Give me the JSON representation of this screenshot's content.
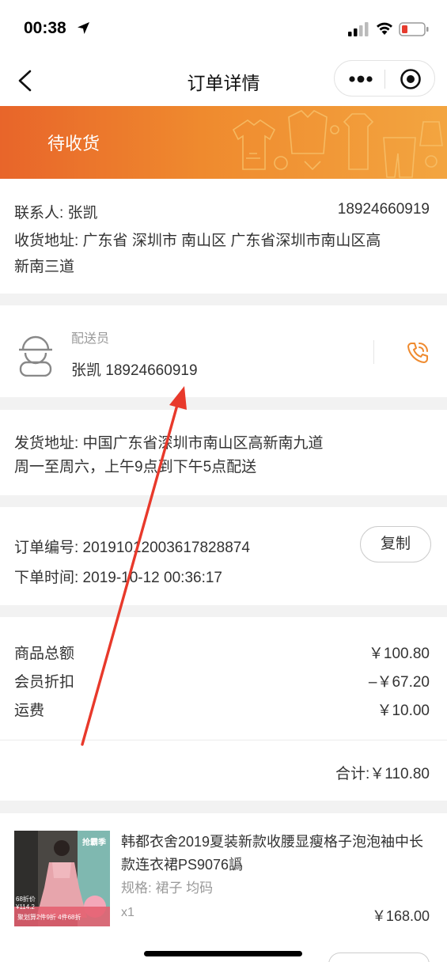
{
  "status_bar": {
    "time": "00:38"
  },
  "nav": {
    "title": "订单详情"
  },
  "banner": {
    "status": "待收货"
  },
  "contact": {
    "name_label": "联系人: 张凯",
    "phone": "18924660919",
    "address_line1": "收货地址: 广东省  深圳市  南山区  广东省深圳市南山区高",
    "address_line2": "新南三道"
  },
  "courier": {
    "label": "配送员",
    "info": "张凯   18924660919"
  },
  "shipping": {
    "address": "发货地址: 中国广东省深圳市南山区高新南九道",
    "hours": "周一至周六，上午9点到下午5点配送"
  },
  "order": {
    "number": "订单编号: 20191012003617828874",
    "time": "下单时间: 2019-10-12 00:36:17",
    "copy_label": "复制"
  },
  "amounts": {
    "rows": [
      {
        "label": "商品总额",
        "value": "￥100.80"
      },
      {
        "label": "会员折扣",
        "value": "–￥67.20"
      },
      {
        "label": "运费",
        "value": "￥10.00"
      }
    ],
    "total": "合计:￥110.80"
  },
  "product": {
    "title": "韩都衣舍2019夏装新款收腰显瘦格子泡泡袖中长款连衣裙PS9076譌",
    "spec": "规格:  裙子  均码",
    "qty": "x1",
    "price": "￥168.00",
    "thumb_badge": "抢霸季",
    "thumb_price_tag": "68折价 ¥114.2",
    "thumb_footer": "聚划算2件9折 4件68折"
  },
  "colors": {
    "accent": "#ef8a2e",
    "banner_start": "#e8652a",
    "annotation": "#e8392b"
  }
}
